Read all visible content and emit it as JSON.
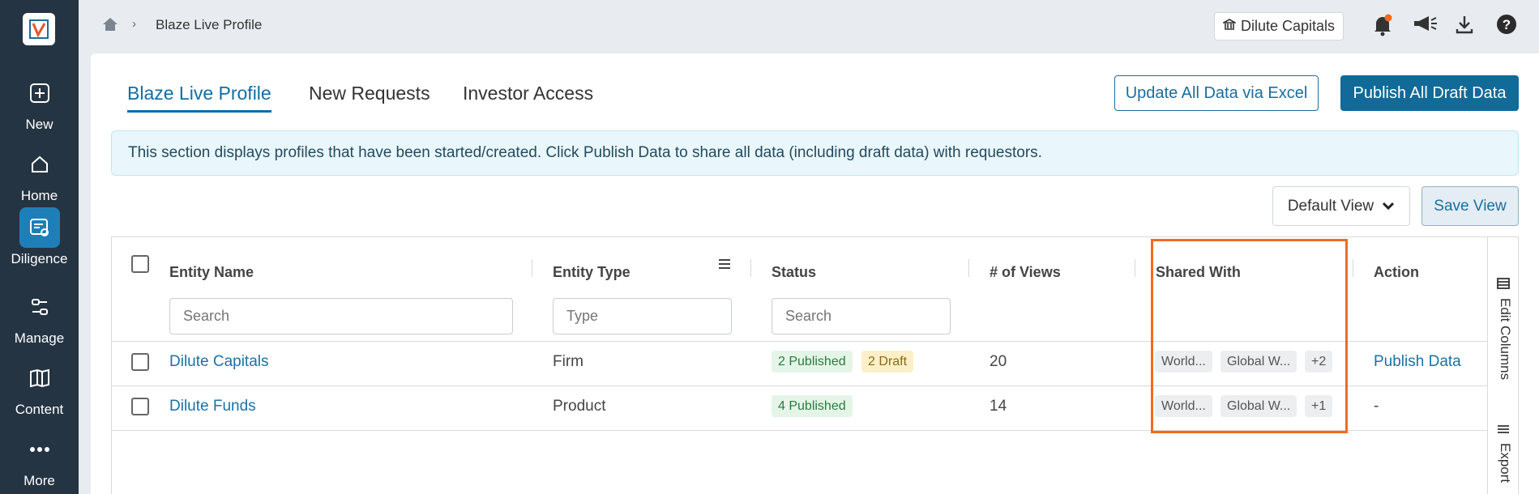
{
  "sidebar": {
    "items": [
      {
        "label": "New"
      },
      {
        "label": "Home"
      },
      {
        "label": "Diligence"
      },
      {
        "label": "Manage"
      },
      {
        "label": "Content"
      },
      {
        "label": "More"
      }
    ],
    "active": "Diligence"
  },
  "header": {
    "breadcrumb_title": "Blaze Live Profile",
    "org_name": "Dilute Capitals"
  },
  "tabs": [
    {
      "label": "Blaze Live Profile",
      "active": true
    },
    {
      "label": "New Requests"
    },
    {
      "label": "Investor Access"
    }
  ],
  "actions": {
    "update_excel": "Update All Data via Excel",
    "publish_all": "Publish All Draft Data"
  },
  "banner": "This section displays profiles that have been started/created. Click Publish Data to share all data (including draft data) with requestors.",
  "view": {
    "selected": "Default View",
    "save": "Save View"
  },
  "table": {
    "columns": [
      "Entity Name",
      "Entity Type",
      "Status",
      "# of Views",
      "Shared With",
      "Action"
    ],
    "filters": {
      "entity_name_placeholder": "Search",
      "entity_type_placeholder": "Type",
      "status_placeholder": "Search"
    },
    "rows": [
      {
        "name": "Dilute Capitals",
        "type": "Firm",
        "published": "2 Published",
        "draft": "2 Draft",
        "views": "20",
        "shared": [
          "World...",
          "Global W...",
          "+2"
        ],
        "action": "Publish Data"
      },
      {
        "name": "Dilute Funds",
        "type": "Product",
        "published": "4 Published",
        "draft": "",
        "views": "14",
        "shared": [
          "World...",
          "Global W...",
          "+1"
        ],
        "action": "-"
      }
    ],
    "rail": {
      "edit_columns": "Edit Columns",
      "export": "Export"
    }
  },
  "colors": {
    "sidebar_bg": "#253443",
    "accent": "#116a98",
    "highlight": "#f26b1d"
  }
}
